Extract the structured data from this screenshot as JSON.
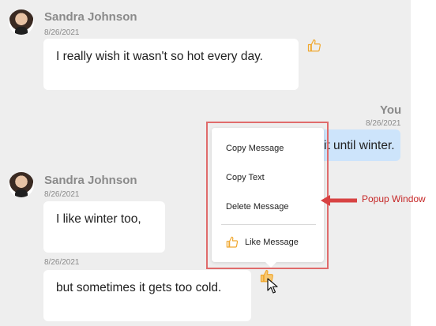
{
  "messages": [
    {
      "sender": "Sandra Johnson",
      "date": "8/26/2021",
      "text": "I really wish it wasn't so hot every day."
    },
    {
      "sender": "You",
      "date": "8/26/2021",
      "text": "it until winter."
    },
    {
      "sender": "Sandra Johnson",
      "date": "8/26/2021",
      "text": "I like winter too,"
    },
    {
      "date": "8/26/2021",
      "text": "but sometimes it gets too cold."
    }
  ],
  "popup": {
    "items": [
      "Copy Message",
      "Copy Text",
      "Delete Message"
    ],
    "like_label": "Like Message",
    "like_icon": "thumbs-up-icon"
  },
  "annotation": {
    "label": "Popup Window",
    "color": "#c62828"
  },
  "colors": {
    "accent_like": "#f0a830",
    "my_bubble": "#cde4fb",
    "frame": "#e06b6b"
  }
}
